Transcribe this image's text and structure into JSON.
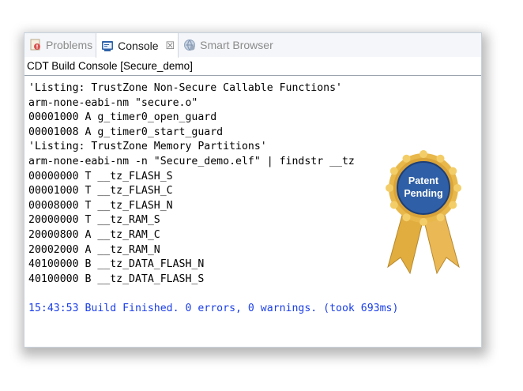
{
  "tabs": [
    {
      "label": "Problems",
      "icon": "problems-icon"
    },
    {
      "label": "Console",
      "icon": "console-icon",
      "close": "☒"
    },
    {
      "label": "Smart Browser",
      "icon": "smart-browser-icon"
    }
  ],
  "console_title": "CDT Build Console [Secure_demo]",
  "console_lines": [
    "'Listing: TrustZone Non-Secure Callable Functions'",
    "arm-none-eabi-nm \"secure.o\"",
    "00001000 A g_timer0_open_guard",
    "00001008 A g_timer0_start_guard",
    "'Listing: TrustZone Memory Partitions'",
    "arm-none-eabi-nm -n \"Secure_demo.elf\" | findstr __tz",
    "00000000 T __tz_FLASH_S",
    "00001000 T __tz_FLASH_C",
    "00008000 T __tz_FLASH_N",
    "20000000 T __tz_RAM_S",
    "20000800 A __tz_RAM_C",
    "20002000 A __tz_RAM_N",
    "40100000 B __tz_DATA_FLASH_N",
    "40100000 B __tz_DATA_FLASH_S"
  ],
  "build_status": "15:43:53 Build Finished. 0 errors, 0 warnings. (took 693ms)",
  "badge": {
    "line1": "Patent",
    "line2": "Pending"
  },
  "colors": {
    "info_text": "#1a3ee6",
    "badge_blue": "#2f5fa6",
    "ribbon_gold": "#e8b84a"
  }
}
